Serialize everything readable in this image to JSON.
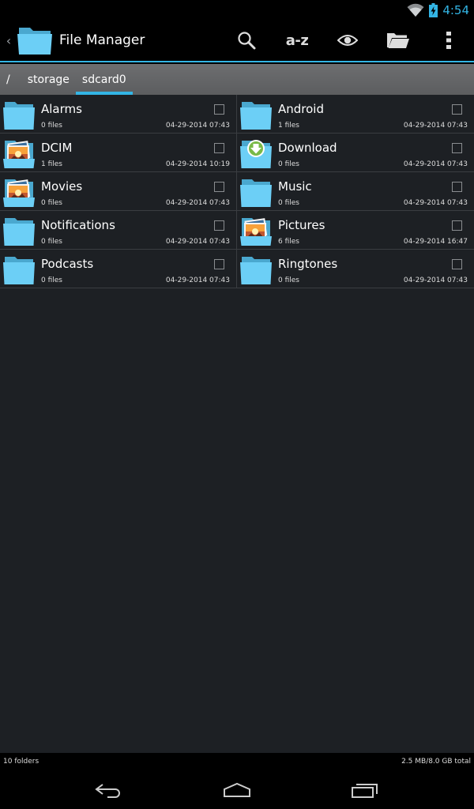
{
  "status": {
    "time": "4:54"
  },
  "app": {
    "title": "File Manager"
  },
  "toolbar": {
    "sort_label": "a-z"
  },
  "breadcrumb": [
    {
      "label": "/"
    },
    {
      "label": "storage"
    },
    {
      "label": "sdcard0"
    }
  ],
  "folders": [
    {
      "name": "Alarms",
      "files": "0 files",
      "date": "04-29-2014 07:43",
      "icon": "folder-icon"
    },
    {
      "name": "Android",
      "files": "1 files",
      "date": "04-29-2014 07:43",
      "icon": "folder-icon"
    },
    {
      "name": "DCIM",
      "files": "1 files",
      "date": "04-29-2014 10:19",
      "icon": "pictures-folder-icon"
    },
    {
      "name": "Download",
      "files": "0 files",
      "date": "04-29-2014 07:43",
      "icon": "download-folder-icon"
    },
    {
      "name": "Movies",
      "files": "0 files",
      "date": "04-29-2014 07:43",
      "icon": "pictures-folder-icon"
    },
    {
      "name": "Music",
      "files": "0 files",
      "date": "04-29-2014 07:43",
      "icon": "folder-icon"
    },
    {
      "name": "Notifications",
      "files": "0 files",
      "date": "04-29-2014 07:43",
      "icon": "folder-icon"
    },
    {
      "name": "Pictures",
      "files": "6 files",
      "date": "04-29-2014 16:47",
      "icon": "pictures-folder-icon"
    },
    {
      "name": "Podcasts",
      "files": "0 files",
      "date": "04-29-2014 07:43",
      "icon": "folder-icon"
    },
    {
      "name": "Ringtones",
      "files": "0 files",
      "date": "04-29-2014 07:43",
      "icon": "folder-icon"
    }
  ],
  "footer": {
    "count": "10 folders",
    "storage": "2.5 MB/8.0 GB total"
  },
  "colors": {
    "accent": "#33b5e5",
    "folder": "#6ccff6",
    "background": "#1d2024"
  }
}
